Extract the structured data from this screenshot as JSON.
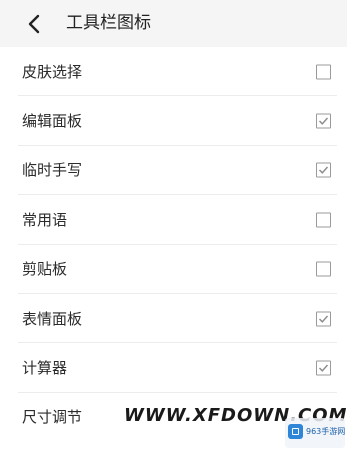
{
  "header": {
    "title": "工具栏图标",
    "back_icon": "chevron-left-icon"
  },
  "items": [
    {
      "label": "皮肤选择",
      "checked": false
    },
    {
      "label": "编辑面板",
      "checked": true
    },
    {
      "label": "临时手写",
      "checked": true
    },
    {
      "label": "常用语",
      "checked": false
    },
    {
      "label": "剪贴板",
      "checked": false
    },
    {
      "label": "表情面板",
      "checked": true
    },
    {
      "label": "计算器",
      "checked": true
    },
    {
      "label": "尺寸调节",
      "checked": null
    }
  ],
  "watermark": {
    "text": "WWW.XFDOWN.COM",
    "badge_text": "963手游网"
  },
  "colors": {
    "header_bg": "#f5f5f5",
    "check_color": "#8a8a8a",
    "separator": "#ececec"
  }
}
